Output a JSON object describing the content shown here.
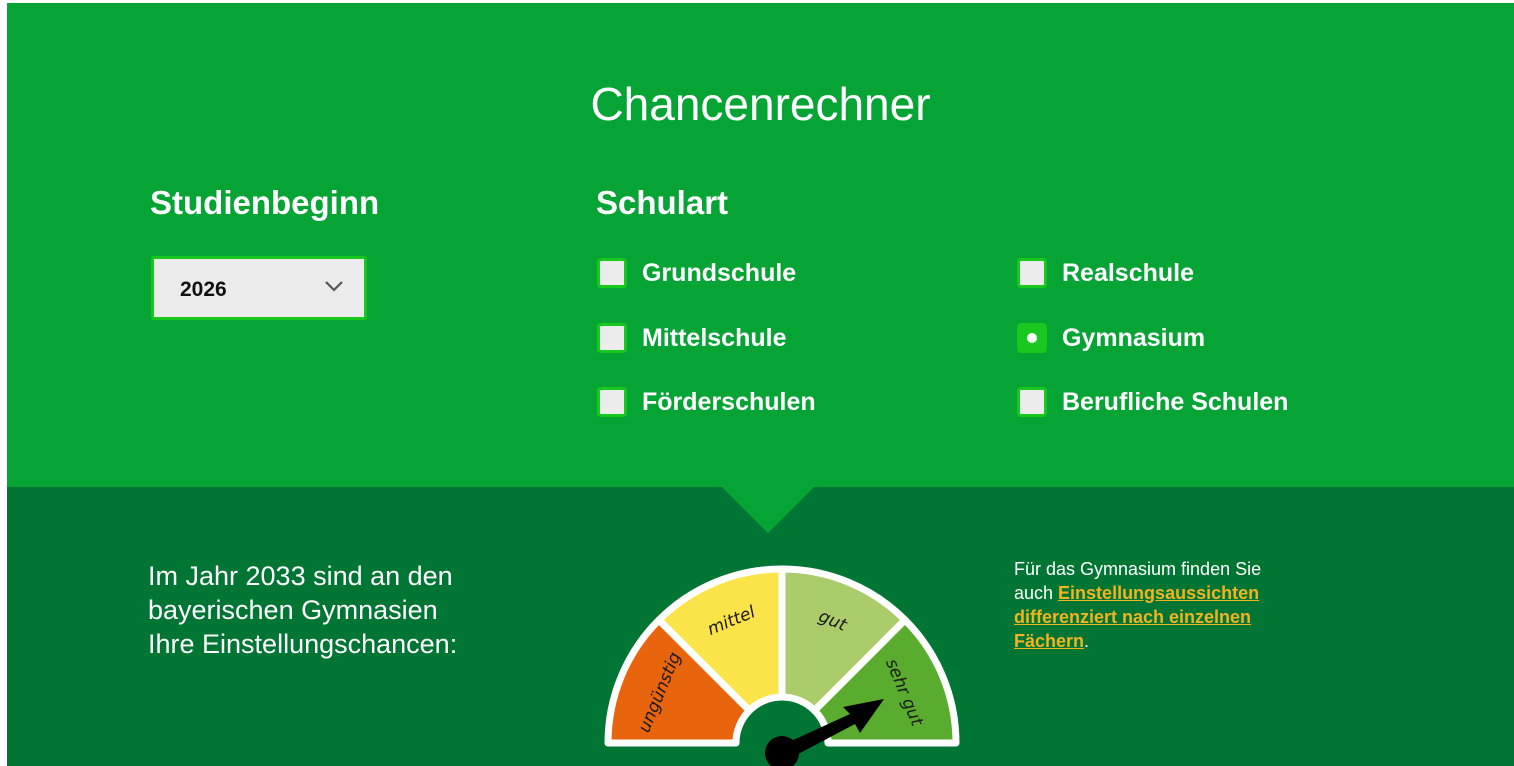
{
  "title": "Chancenrechner",
  "studienbeginn": {
    "heading": "Studienbeginn",
    "selected": "2026"
  },
  "schulart": {
    "heading": "Schulart",
    "options": [
      {
        "label": "Grundschule",
        "selected": false
      },
      {
        "label": "Mittelschule",
        "selected": false
      },
      {
        "label": "Förderschulen",
        "selected": false
      },
      {
        "label": "Realschule",
        "selected": false
      },
      {
        "label": "Gymnasium",
        "selected": true
      },
      {
        "label": "Berufliche Schulen",
        "selected": false
      }
    ]
  },
  "result": {
    "lines": [
      "Im Jahr 2033 sind an den",
      "bayerischen Gymnasien",
      "Ihre Einstellungschancen:"
    ]
  },
  "gauge": {
    "segments": [
      {
        "label": "ungünstig",
        "color": "#e8650e"
      },
      {
        "label": "mittel",
        "color": "#fbe34a"
      },
      {
        "label": "gut",
        "color": "#abcc6b"
      },
      {
        "label": "sehr gut",
        "color": "#5aac2f"
      }
    ],
    "value": "sehr gut"
  },
  "side_note": {
    "line1": "Für das Gymnasium finden Sie",
    "line2_prefix": "auch ",
    "link_part1": "Einstellungsaussichten",
    "link_part2": "differenziert nach einzelnen",
    "link_part3": "Fächern",
    "suffix": "."
  },
  "colors": {
    "primary_green": "#05a435",
    "dark_green": "#007534",
    "accent_green": "#19c81f",
    "link_orange": "#f2b31f"
  }
}
